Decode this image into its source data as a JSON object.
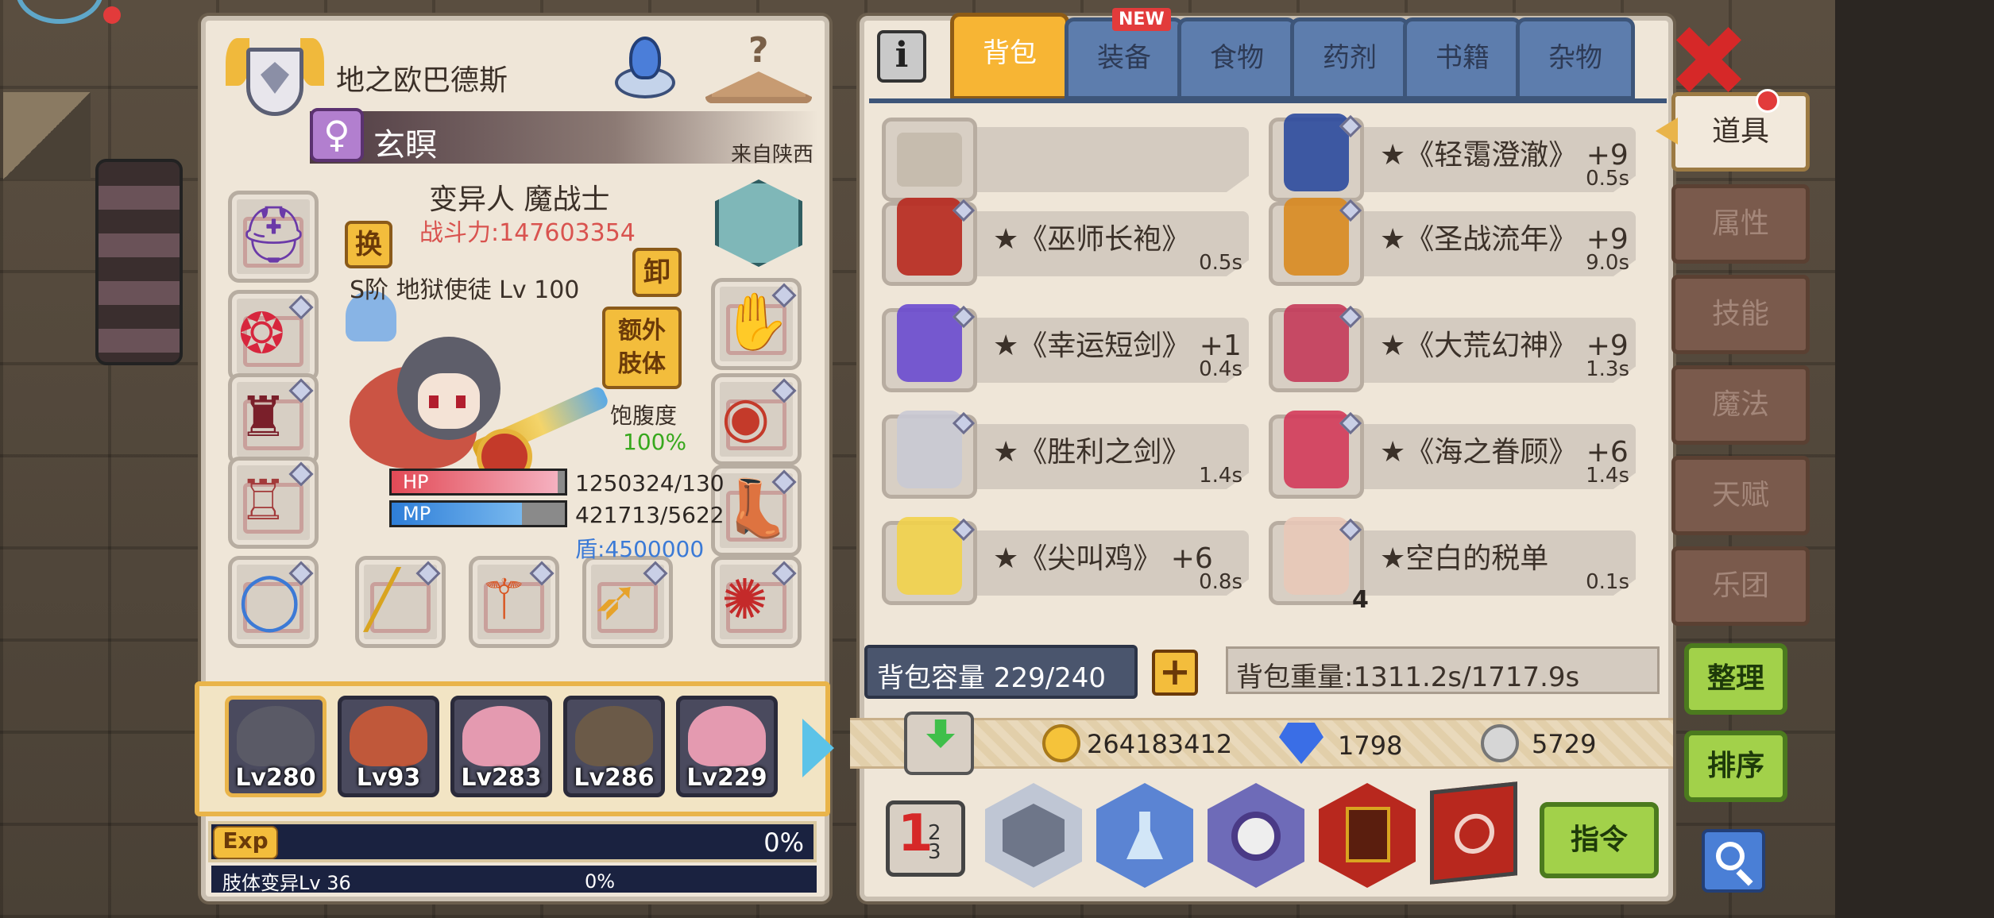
{
  "character": {
    "title": "地之欧巴德斯",
    "name": "玄瞑",
    "gender_symbol": "♀",
    "origin": "来自陕西",
    "class": "变异人 魔战士",
    "power": "战斗力:147603354",
    "swap_button": "换",
    "unequip_button": "卸",
    "extra_limb_button": "额外肢体",
    "pet_label": "S阶 地狱使徒 Lv 100",
    "satiety_label": "饱腹度",
    "satiety_value": "100%",
    "hp_label": "HP",
    "hp_value": "1250324/130",
    "hp_fraction": 0.96,
    "mp_label": "MP",
    "mp_value": "421713/5622",
    "mp_fraction": 0.75,
    "shield": "盾:4500000"
  },
  "party": [
    {
      "level": "Lv280",
      "color": "#5a5a66"
    },
    {
      "level": "Lv93",
      "color": "#c0583a"
    },
    {
      "level": "Lv283",
      "color": "#e49ab0"
    },
    {
      "level": "Lv286",
      "color": "#6b5a48"
    },
    {
      "level": "Lv229",
      "color": "#e49ab0"
    }
  ],
  "exp": {
    "label": "Exp",
    "percent": "0%",
    "limb_label": "肢体变异Lv 36",
    "limb_percent": "0%"
  },
  "tabs": {
    "backpack": "背包",
    "equipment": "装备",
    "equipment_badge": "NEW",
    "food": "食物",
    "potion": "药剂",
    "books": "书籍",
    "misc": "杂物"
  },
  "items": [
    {
      "name": "",
      "weight": "",
      "icon": "empty-slot"
    },
    {
      "name": "★《轻霭澄澈》 +9",
      "weight": "0.5s",
      "icon": "blue-cape-icon"
    },
    {
      "name": "★《巫师长袍》",
      "weight": "0.5s",
      "icon": "wizard-robe-icon"
    },
    {
      "name": "★《圣战流年》 +9",
      "weight": "9.0s",
      "icon": "golden-armor-icon"
    },
    {
      "name": "★《幸运短剑》 +1",
      "weight": "0.4s",
      "icon": "short-sword-icon"
    },
    {
      "name": "★《大荒幻神》 +9",
      "weight": "1.3s",
      "icon": "blade-icon"
    },
    {
      "name": "★《胜利之剑》",
      "weight": "1.4s",
      "icon": "sword-icon"
    },
    {
      "name": "★《海之眷顾》 +6",
      "weight": "1.4s",
      "icon": "trident-icon"
    },
    {
      "name": "★《尖叫鸡》 +6",
      "weight": "0.8s",
      "icon": "rubber-chicken-icon"
    },
    {
      "name": "★空白的税单",
      "weight": "0.1s",
      "icon": "tax-form-icon",
      "count": "4"
    }
  ],
  "capacity": "背包容量 229/240",
  "weight": "背包重量:1311.2s/1717.9s",
  "currency": {
    "gold": "264183412",
    "diamond": "1798",
    "silver": "5729"
  },
  "side_tabs": [
    "道具",
    "属性",
    "技能",
    "魔法",
    "天赋",
    "乐团"
  ],
  "buttons": {
    "organize": "整理",
    "sort": "排序",
    "command": "指令"
  }
}
